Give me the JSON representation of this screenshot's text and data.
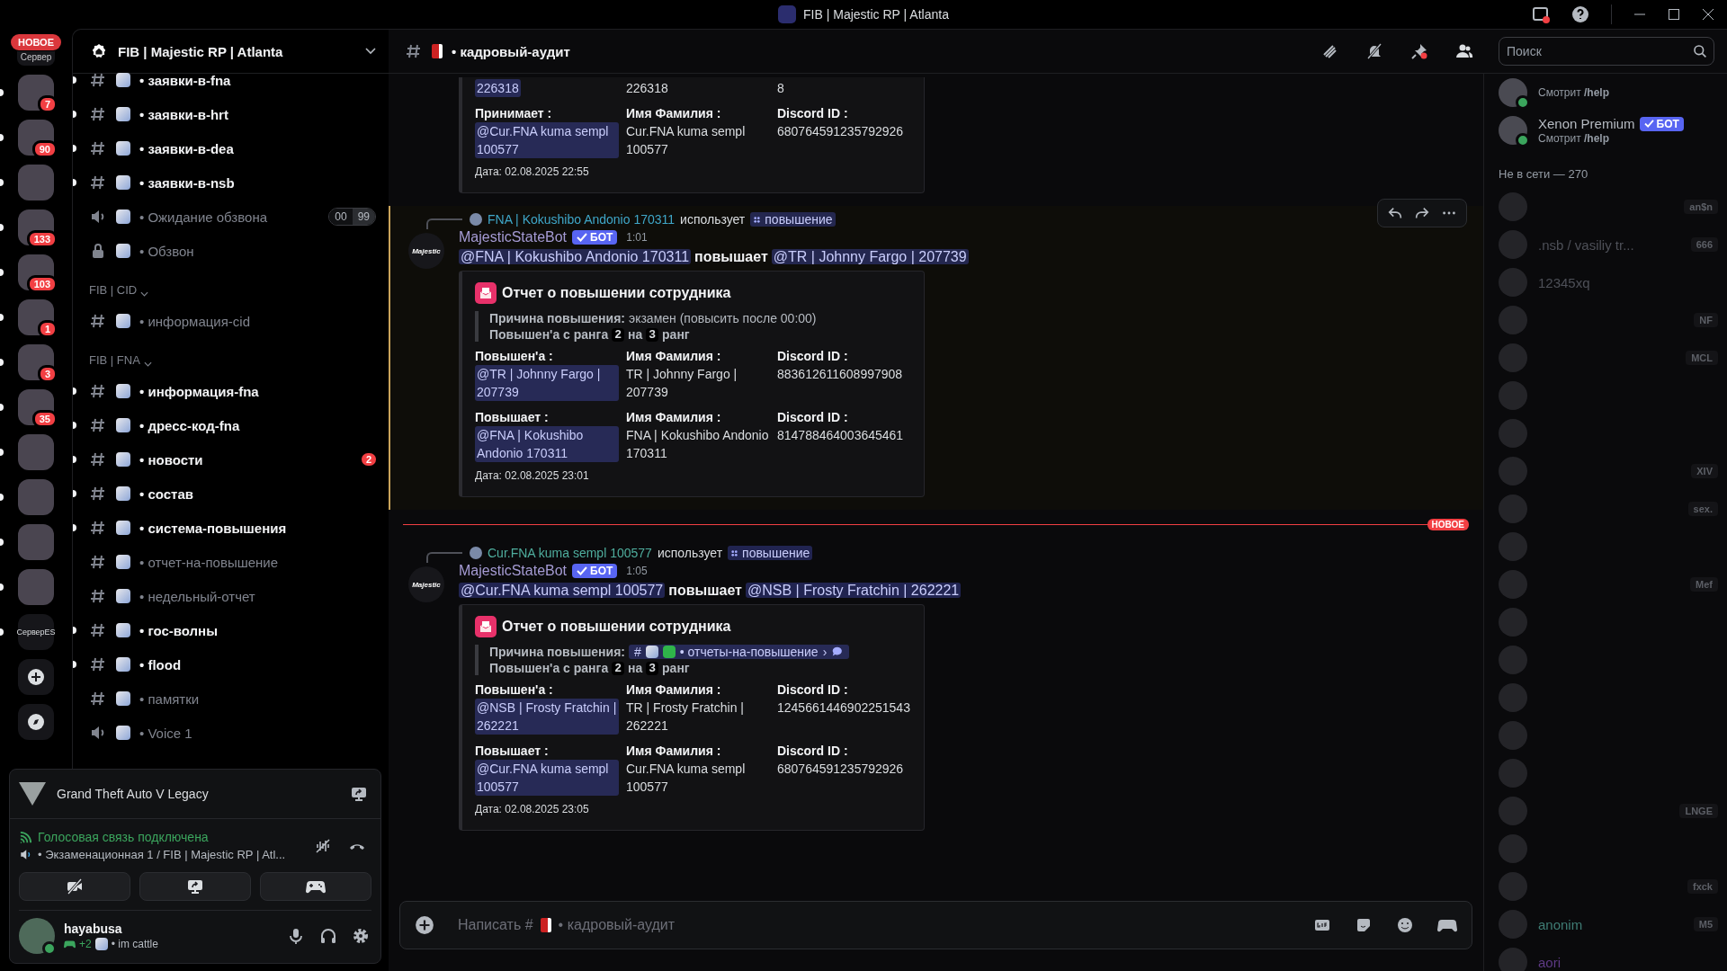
{
  "window": {
    "title": "FIB | Majestic RP | Atlanta"
  },
  "servers": {
    "top": {
      "label": "Сервер",
      "pill": "НОВОЕ"
    },
    "items": [
      {
        "unread": true,
        "badge": "7"
      },
      {
        "unread": true,
        "badge": "90"
      },
      {
        "unread": true
      },
      {
        "unread": true,
        "badge": "133"
      },
      {
        "unread": true,
        "badge": "103"
      },
      {
        "unread": true,
        "badge": "1"
      },
      {
        "unread": true,
        "badge": "3"
      },
      {
        "unread": true,
        "badge": "35"
      },
      {
        "unread": true
      },
      {
        "unread": true
      },
      {
        "unread": true
      },
      {
        "unread": true
      },
      {
        "unread": true,
        "label": "СерверES"
      }
    ]
  },
  "sidebar": {
    "server_name": "FIB | Majestic RP | Atlanta",
    "channels": [
      {
        "kind": "text",
        "name": "• заявки-в-fna",
        "unread": true
      },
      {
        "kind": "text",
        "name": "• заявки-в-hrt",
        "unread": true
      },
      {
        "kind": "text",
        "name": "• заявки-в-dea",
        "unread": true
      },
      {
        "kind": "text",
        "name": "• заявки-в-nsb",
        "unread": true
      },
      {
        "kind": "voice",
        "name": "• Ожидание обзвона",
        "unread": false,
        "users": "00",
        "limit": "99"
      },
      {
        "kind": "locked",
        "name": "• Обзвон",
        "unread": false
      },
      {
        "kind": "category",
        "name": "FIB | CID"
      },
      {
        "kind": "text",
        "name": "• информация-cid",
        "unread": false
      },
      {
        "kind": "category",
        "name": "FIB | FNA"
      },
      {
        "kind": "text",
        "name": "• информация-fna",
        "unread": true
      },
      {
        "kind": "text",
        "name": "• дресс-код-fna",
        "unread": true
      },
      {
        "kind": "text",
        "name": "• новости",
        "unread": true,
        "badge": "2"
      },
      {
        "kind": "text",
        "name": "• состав",
        "unread": true
      },
      {
        "kind": "text",
        "name": "• система-повышения",
        "unread": true
      },
      {
        "kind": "text",
        "name": "• отчет-на-повышение",
        "unread": false
      },
      {
        "kind": "text",
        "name": "• недельный-отчет",
        "unread": false
      },
      {
        "kind": "text",
        "name": "• гос-волны",
        "unread": true
      },
      {
        "kind": "text",
        "name": "• flood",
        "unread": true
      },
      {
        "kind": "text",
        "name": "• памятки",
        "unread": false
      },
      {
        "kind": "voice",
        "name": "• Voice 1",
        "unread": false
      }
    ]
  },
  "activity": {
    "game": "Grand Theft Auto V Legacy",
    "voice_status": "Голосовая связь подключена",
    "voice_channel": "• Экзаменационная 1 / FIB | Majestic RP | Atl..."
  },
  "user": {
    "name": "hayabusa",
    "extra": "+2",
    "status": "• im cattle",
    "online": true
  },
  "chat": {
    "channel": "• кадровый-аудит",
    "search": {
      "placeholder": "Поиск"
    },
    "messages": [
      {
        "kind": "embed_tail",
        "embed": {
          "fields": [
            {
              "value": "226318",
              "mention": true
            },
            {
              "value": "226318",
              "mention": false
            },
            {
              "value": "8",
              "mention": false
            },
            {
              "label": "Принимает :",
              "value": "@Cur.FNA kuma sempl 100577",
              "mention": true
            },
            {
              "label": "Имя Фамилия :",
              "value": "Cur.FNA kuma sempl 100577",
              "mention": false
            },
            {
              "label": "Discord ID :",
              "value": "680764591235792926",
              "mention": false
            }
          ],
          "date": "Дата: 02.08.2025 22:55"
        }
      },
      {
        "kind": "message",
        "highlighted": true,
        "reply": {
          "user": "FNA | Kokushibo Andonio 170311",
          "color": "#3fa7c9",
          "verb": "использует",
          "command": "повышение"
        },
        "author": "MajesticStateBot",
        "avatar": "Majestic",
        "tag": "БОТ",
        "time": "1:01",
        "content": {
          "from": "@FNA | Kokushibo Andonio 170311",
          "verb": "повышает",
          "to": "@TR | Johnny Fargo |  207739"
        },
        "embed": {
          "title": "Отчет о повышении сотрудника",
          "reason": {
            "label": "Причина повышения:",
            "kind": "text",
            "text": "экзамен (повысить после 00:00)"
          },
          "rank": {
            "before": "Повышен'а с ранга",
            "from": "2",
            "middle": "на",
            "to": "3",
            "after": "ранг"
          },
          "fields": [
            {
              "label": "Повышен'а :",
              "value": "@TR | Johnny Fargo | 207739",
              "mention": true
            },
            {
              "label": "Имя Фамилия :",
              "value": "TR | Johnny Fargo | 207739",
              "mention": false
            },
            {
              "label": "Discord ID :",
              "value": "883612611608997908",
              "mention": false
            },
            {
              "label": "Повышает :",
              "value": "@FNA | Kokushibo Andonio 170311",
              "mention": true
            },
            {
              "label": "Имя Фамилия :",
              "value": "FNA | Kokushibo Andonio 170311",
              "mention": false
            },
            {
              "label": "Discord ID :",
              "value": "814788464003645461",
              "mention": false
            }
          ],
          "date": "Дата: 02.08.2025 23:01"
        }
      },
      {
        "kind": "divider",
        "label": "НОВОЕ"
      },
      {
        "kind": "message",
        "highlighted": false,
        "reply": {
          "user": "Cur.FNA  kuma sempl  100577",
          "color": "#4fae9e",
          "verb": "использует",
          "command": "повышение"
        },
        "author": "MajesticStateBot",
        "avatar": "Majestic",
        "tag": "БОТ",
        "time": "1:05",
        "content": {
          "from": "@Cur.FNA  kuma sempl  100577",
          "verb": "повышает",
          "to": "@NSB | Frosty Fratchin | 262221"
        },
        "embed": {
          "title": "Отчет о повышении сотрудника",
          "reason": {
            "label": "Причина повышения:",
            "kind": "channel",
            "prefix": "#",
            "text": "• отчеты-на-повышение",
            "suffix": "›"
          },
          "rank": {
            "before": "Повышен'а с ранга",
            "from": "2",
            "middle": "на",
            "to": "3",
            "after": "ранг"
          },
          "fields": [
            {
              "label": "Повышен'а :",
              "value": "@NSB | Frosty Fratchin | 262221",
              "mention": true
            },
            {
              "label": "Имя Фамилия :",
              "value": "TR | Frosty Fratchin | 262221",
              "mention": false
            },
            {
              "label": "Discord ID :",
              "value": "1245661446902251543",
              "mention": false
            },
            {
              "label": "Повышает :",
              "value": "@Cur.FNA kuma sempl 100577",
              "mention": true
            },
            {
              "label": "Имя Фамилия :",
              "value": "Cur.FNA kuma sempl 100577",
              "mention": false
            },
            {
              "label": "Discord ID :",
              "value": "680764591235792926",
              "mention": false
            }
          ],
          "date": "Дата: 02.08.2025 23:05"
        }
      }
    ],
    "composer": {
      "placeholder_start": "Написать #",
      "placeholder_end": "• кадровый-аудит"
    }
  },
  "members": {
    "online": [
      {
        "activity": "Смотрит **/help**",
        "online": true
      },
      {
        "name": "Xenon Premium",
        "tag": "БОТ",
        "activity": "Смотрит **/help**",
        "online": true
      }
    ],
    "offline_heading": "Не в сети — 270",
    "offline": [
      {
        "dimmed": true,
        "badge": "an$n"
      },
      {
        "dimmed": true,
        "name": ".nsb / vasiliy tr...",
        "badge": "666"
      },
      {
        "dimmed": true,
        "name": "12345xq"
      },
      {
        "dimmed": true,
        "badge": "NF"
      },
      {
        "dimmed": true,
        "badge": "MCL"
      },
      {
        "dimmed": true
      },
      {
        "dimmed": true
      },
      {
        "dimmed": true,
        "badge": "XIV"
      },
      {
        "dimmed": true,
        "badge": "sex."
      },
      {
        "dimmed": true
      },
      {
        "dimmed": true,
        "badge": "Mef"
      },
      {
        "dimmed": true
      },
      {
        "dimmed": true
      },
      {
        "dimmed": true
      },
      {
        "dimmed": true
      },
      {
        "dimmed": true
      },
      {
        "dimmed": true,
        "badge": "LNGE"
      },
      {
        "dimmed": true
      },
      {
        "dimmed": true,
        "badge": "fxck"
      },
      {
        "dimmed": true,
        "name": "anonim",
        "color": "#3f7d75",
        "badge": "M5"
      },
      {
        "dimmed": true,
        "name": "aori",
        "color": "#5e3a85"
      }
    ]
  }
}
